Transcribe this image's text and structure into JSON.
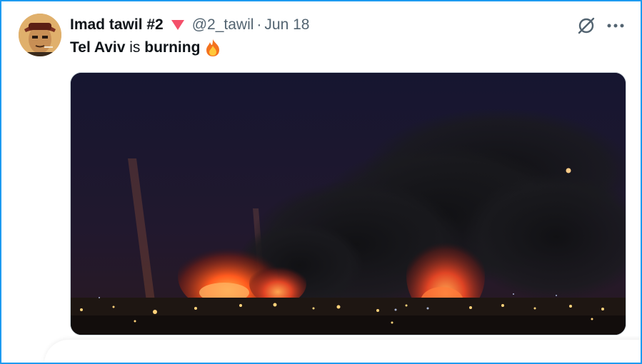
{
  "tweet": {
    "display_name": "Imad tawil #2",
    "handle": "@2_tawil",
    "separator": "·",
    "date": "Jun 18",
    "text_part1": "Tel Aviv",
    "text_part2": " is ",
    "text_part3": "burning",
    "emoji": "fire-emoji",
    "badge_icon": "red-triangle-icon",
    "badge_color": "#f4506a"
  },
  "actions": {
    "grok_icon": "grok-icon",
    "more_icon": "more-dots-icon"
  },
  "colors": {
    "border": "#1d9bf0",
    "text": "#0f1419",
    "secondary": "#536471"
  }
}
